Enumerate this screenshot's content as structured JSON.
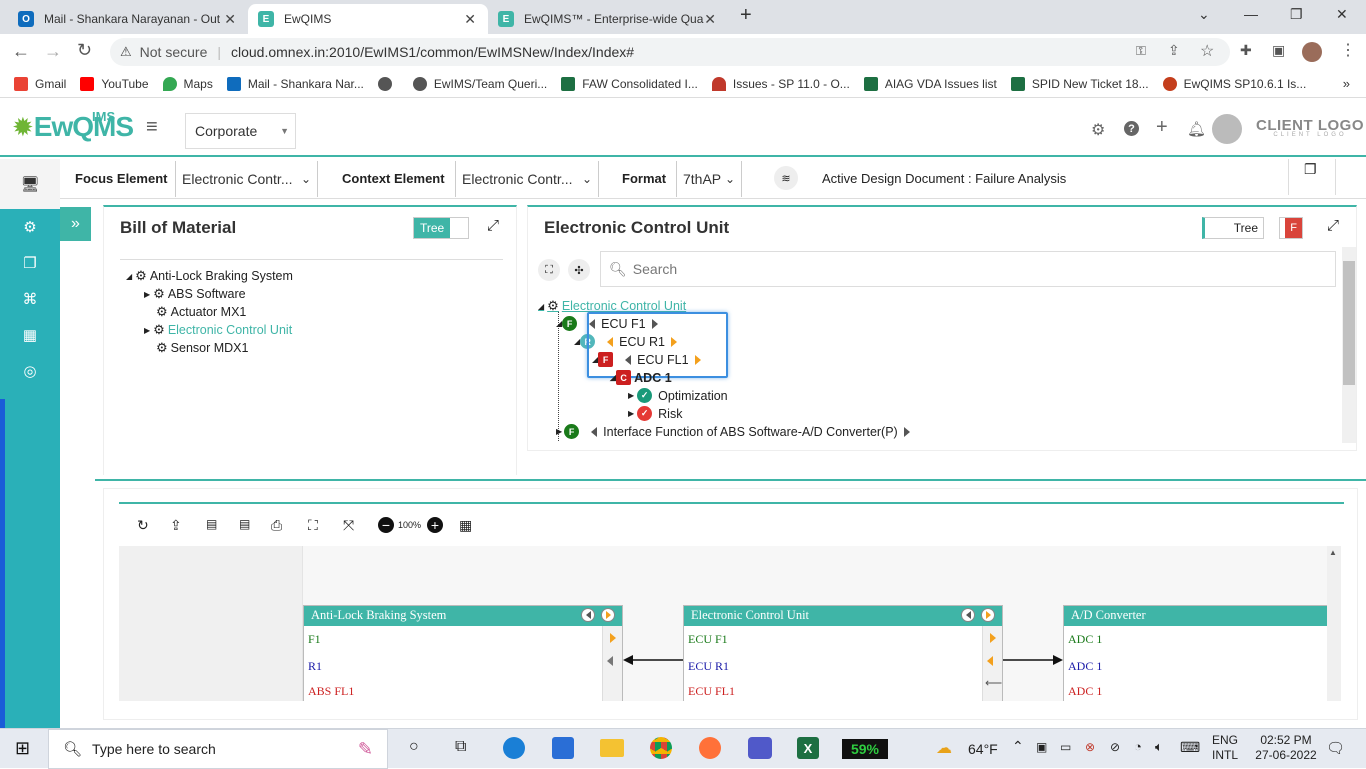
{
  "browser": {
    "tabs": [
      {
        "label": "Mail - Shankara Narayanan - Out",
        "icon_color": "#0f6cbd",
        "icon_letter": "O"
      },
      {
        "label": "EwQIMS",
        "icon_color": "#3fb5a7",
        "icon_letter": "E"
      },
      {
        "label": "EwQIMS™ - Enterprise-wide Qua",
        "icon_color": "#3fb5a7",
        "icon_letter": "E"
      }
    ],
    "security": "Not secure",
    "url": "cloud.omnex.in:2010/EwIMS1/common/EwIMSNew/Index/Index#",
    "bookmarks": [
      {
        "label": "Gmail",
        "color": "#ea4335"
      },
      {
        "label": "YouTube",
        "color": "#ff0000"
      },
      {
        "label": "Maps",
        "color": "#34a853"
      },
      {
        "label": "Mail - Shankara Nar...",
        "color": "#0f6cbd"
      },
      {
        "label": "",
        "color": "#555"
      },
      {
        "label": "EwIMS/Team Queri...",
        "color": "#555"
      },
      {
        "label": "FAW Consolidated I...",
        "color": "#1d6f42"
      },
      {
        "label": "Issues - SP 11.0 - O...",
        "color": "#c0392b"
      },
      {
        "label": "AIAG VDA Issues list",
        "color": "#1d6f42"
      },
      {
        "label": "SPID New Ticket 18...",
        "color": "#1d6f42"
      },
      {
        "label": "EwQIMS SP10.6.1 Is...",
        "color": "#c43e1c"
      }
    ]
  },
  "app": {
    "logo_main": "EwQMS",
    "logo_ims": "IMS",
    "org_select": "Corporate",
    "client_logo": "CLIENT LOGO",
    "client_logo_sub": "CLIENT LOGO"
  },
  "filters": {
    "focus_label": "Focus Element",
    "focus_value": "Electronic Contr...",
    "context_label": "Context Element",
    "context_value": "Electronic Contr...",
    "format_label": "Format",
    "format_value": "7thAP",
    "active_doc": "Active Design Document : Failure Analysis"
  },
  "bom": {
    "title": "Bill of Material",
    "toggle": "Tree",
    "items": [
      {
        "label": "Anti-Lock Braking System",
        "level": 0
      },
      {
        "label": "ABS Software",
        "level": 1
      },
      {
        "label": "Actuator MX1",
        "level": 1
      },
      {
        "label": "Electronic Control Unit",
        "level": 1
      },
      {
        "label": "Sensor MDX1",
        "level": 1
      }
    ]
  },
  "ecu": {
    "title": "Electronic Control Unit",
    "toggle": "Tree",
    "badge": "F",
    "search_placeholder": "Search",
    "root": "Electronic Control Unit",
    "nodes": {
      "f1": "ECU F1",
      "r1": "ECU R1",
      "fl1": "ECU FL1",
      "adc": "ADC 1",
      "opt": "Optimization",
      "risk": "Risk",
      "iface": "Interface Function of ABS Software-A/D Converter(P)"
    },
    "badges": {
      "f": "F",
      "r": "R",
      "fl": "F",
      "c": "C"
    }
  },
  "diagram": {
    "zoom": "100%",
    "boxes": [
      {
        "title": "Anti-Lock Braking System",
        "rows": [
          "F1",
          "R1",
          "ABS FL1"
        ]
      },
      {
        "title": "Electronic Control Unit",
        "rows": [
          "ECU F1",
          "ECU R1",
          "ECU FL1"
        ]
      },
      {
        "title": "A/D Converter",
        "rows": [
          "ADC 1",
          "ADC 1",
          "ADC 1"
        ]
      }
    ],
    "row_colors": [
      "#1a7a1a",
      "#1a1aa8",
      "#cc1f1f"
    ]
  },
  "taskbar": {
    "search_placeholder": "Type here to search",
    "battery": "59%",
    "weather": "64°F",
    "lang1": "ENG",
    "lang2": "INTL",
    "time": "02:52 PM",
    "date": "27-06-2022"
  },
  "colors": {
    "accent": "#3fb5a7",
    "sidebar": "#2ab0b8"
  }
}
